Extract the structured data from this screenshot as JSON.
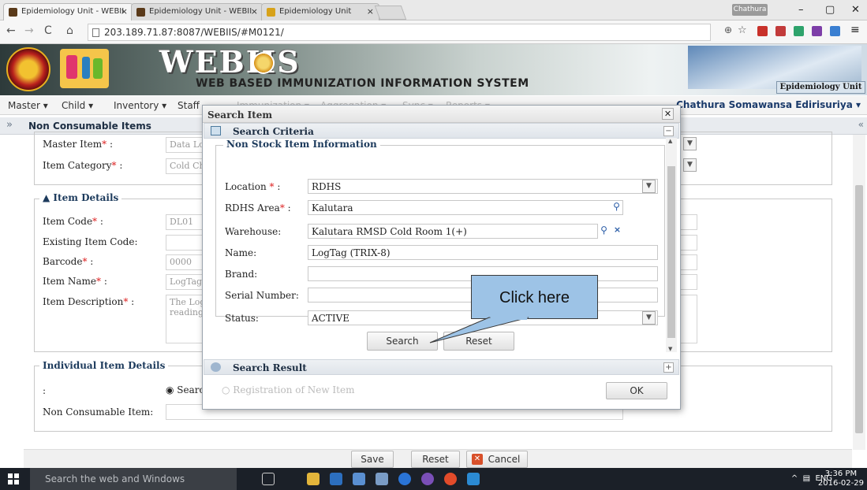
{
  "browser": {
    "tabs": [
      "Epidemiology Unit - WEBII",
      "Epidemiology Unit - WEBII",
      "Epidemiology Unit"
    ],
    "user_chip": "Chathura",
    "url": "203.189.71.87:8087/WEBIIS/#M0121/"
  },
  "banner": {
    "title": "WEBIIS",
    "subtitle": "WEB BASED IMMUNIZATION INFORMATION SYSTEM",
    "unit_label": "Epidemiology Unit"
  },
  "menubar": {
    "items": [
      "Master",
      "Child",
      "Inventory",
      "Staff",
      "Immunization",
      "Aggregation",
      "Sync",
      "Reports"
    ],
    "user": "Chathura Somawansa Edirisuriya"
  },
  "panel": {
    "title": "Non Consumable Items",
    "master_item_label": "Master Item",
    "master_item_value": "Data Lo",
    "item_category_label": "Item Category",
    "item_category_value": "Cold Ch",
    "item_details_legend": "Item Details",
    "item_code_label": "Item Code",
    "item_code_value": "DL01",
    "existing_code_label": "Existing Item Code:",
    "barcode_label": "Barcode",
    "barcode_value": "0000",
    "item_name_label": "Item Name",
    "item_name_value": "LogTag",
    "item_desc_label": "Item Description",
    "item_desc_value": "The Log readings",
    "individual_legend": "Individual Item Details",
    "radio_label": ":",
    "radio_search_label": "Searc",
    "non_consumable_label": "Non Consumable Item:",
    "save": "Save",
    "reset": "Reset",
    "cancel": "Cancel"
  },
  "dialog": {
    "title": "Search Item",
    "criteria_title": "Search Criteria",
    "legend": "Non Stock Item Information",
    "fields": {
      "location_label": "Location",
      "location_value": "RDHS",
      "rdhs_label": "RDHS Area",
      "rdhs_value": "Kalutara",
      "warehouse_label": "Warehouse:",
      "warehouse_value": "Kalutara RMSD Cold Room 1(+)",
      "name_label": "Name:",
      "name_value": "LogTag (TRIX-8)",
      "brand_label": "Brand:",
      "brand_value": "",
      "serial_label": "Serial Number:",
      "serial_value": "",
      "status_label": "Status:",
      "status_value": "ACTIVE"
    },
    "search_btn": "Search",
    "reset_btn": "Reset",
    "result_title": "Search Result",
    "registration_label": "Registration of New Item",
    "ok_btn": "OK"
  },
  "callout": "Click here",
  "taskbar": {
    "search_placeholder": "Search the web and Windows",
    "lang": "ENG",
    "time": "3:36 PM",
    "date": "2016-02-29"
  }
}
